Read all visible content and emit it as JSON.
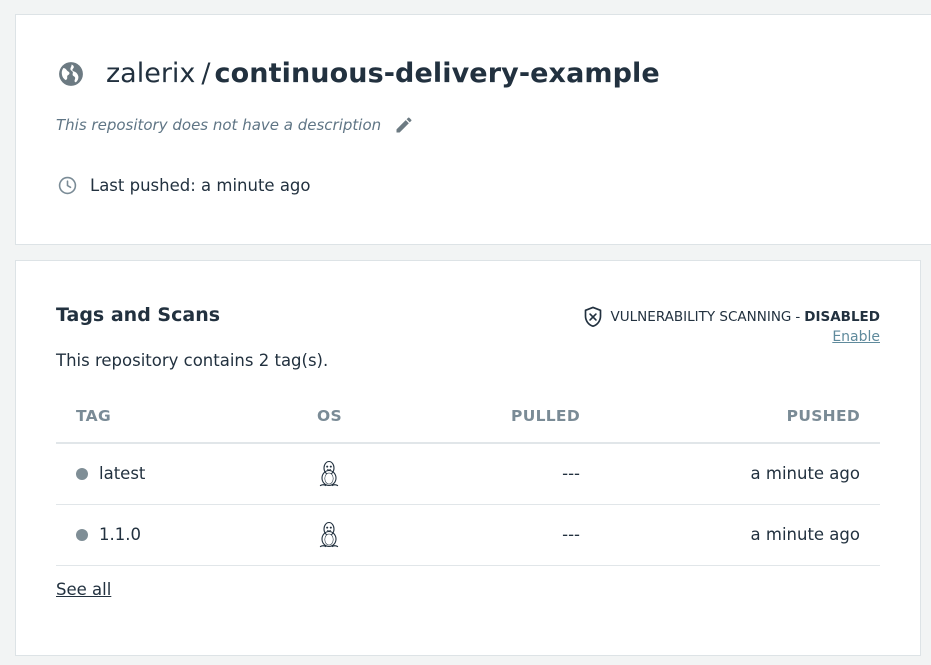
{
  "repo": {
    "namespace": "zalerix",
    "separator": "/",
    "name": "continuous-delivery-example",
    "description": "This repository does not have a description",
    "last_pushed": "Last pushed: a minute ago"
  },
  "tags_section": {
    "title": "Tags and Scans",
    "scan_label": "VULNERABILITY SCANNING",
    "scan_separator": "-",
    "scan_status": "DISABLED",
    "enable_link": "Enable",
    "tag_count_text": "This repository contains 2 tag(s).",
    "columns": [
      "TAG",
      "OS",
      "PULLED",
      "PUSHED"
    ],
    "rows": [
      {
        "tag": "latest",
        "os": "linux-icon",
        "pulled": "---",
        "pushed": "a minute ago"
      },
      {
        "tag": "1.1.0",
        "os": "linux-icon",
        "pulled": "---",
        "pushed": "a minute ago"
      }
    ],
    "see_all": "See all"
  },
  "icons": {
    "repo": "globe-icon",
    "edit": "pencil-icon",
    "time": "clock-icon",
    "scan": "shield-x-icon",
    "os": "linux-icon"
  },
  "colors": {
    "text": "#22313f",
    "muted": "#7a8b96",
    "link": "#5f8a9c",
    "tag_dot": "#7f8e96",
    "background": "#f2f4f4"
  }
}
